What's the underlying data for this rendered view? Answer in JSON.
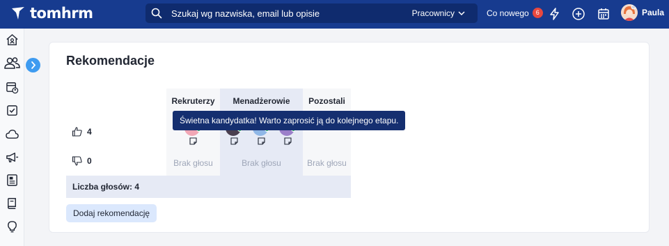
{
  "app": {
    "name": "tomhrm"
  },
  "search": {
    "placeholder": "Szukaj wg nazwiska, email lub opisie",
    "scope": "Pracownicy"
  },
  "header": {
    "whats_new": "Co nowego",
    "whats_new_count": "6",
    "user_name": "Paula"
  },
  "sidebar": {
    "icons": [
      "home-icon",
      "people-icon",
      "calendar-user-icon",
      "checkbox-icon",
      "cloud-icon",
      "megaphone-icon",
      "newspaper-icon",
      "book-icon",
      "lightbulb-icon"
    ]
  },
  "recommendations": {
    "title": "Rekomendacje",
    "columns": [
      "Rekruterzy",
      "Menadżerowie",
      "Pozostali"
    ],
    "thumbs_up_count": "4",
    "thumbs_down_count": "0",
    "no_vote": [
      "Brak głosu",
      "Brak głosu",
      "Brak głosu"
    ],
    "total_votes": "Liczba głosów: 4",
    "add_button": "Dodaj rekomendację",
    "tooltip": "Świetna kandydatka! Warto zaprosić ją do kolejnego etapu."
  },
  "colors": {
    "topbar": "#173b8f",
    "accent": "#3e9bf0",
    "badge": "#e8483f",
    "tooltip": "#152f70"
  }
}
